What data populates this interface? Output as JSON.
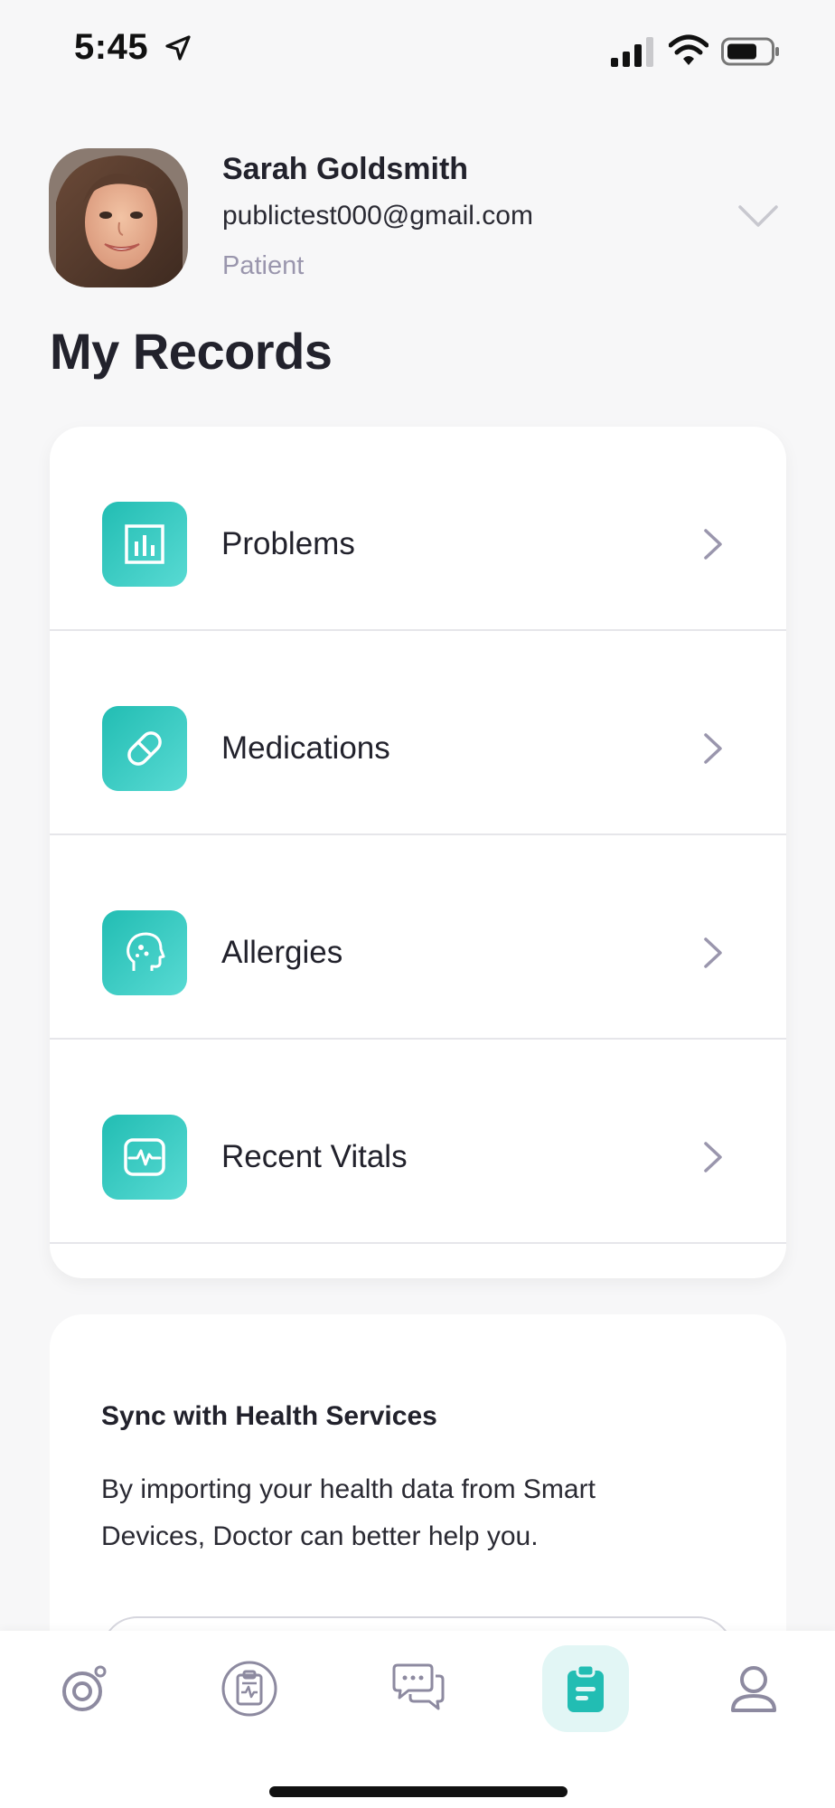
{
  "status_bar": {
    "time": "5:45",
    "icons": [
      "location-arrow-icon",
      "cellular-signal-icon",
      "wifi-icon",
      "battery-icon"
    ]
  },
  "profile": {
    "name": "Sarah Goldsmith",
    "email": "publictest000@gmail.com",
    "role": "Patient"
  },
  "page_title": "My Records",
  "records": [
    {
      "label": "Problems",
      "icon": "bar-chart-icon"
    },
    {
      "label": "Medications",
      "icon": "pill-icon"
    },
    {
      "label": "Allergies",
      "icon": "head-profile-icon"
    },
    {
      "label": "Recent Vitals",
      "icon": "heartbeat-monitor-icon"
    }
  ],
  "sync": {
    "title": "Sync with Health Services",
    "text": "By importing your health data from Smart Devices, Doctor can better help you."
  },
  "tab_bar": {
    "tabs": [
      {
        "name": "home",
        "icon": "target-icon",
        "active": false
      },
      {
        "name": "appointments",
        "icon": "clipboard-ecg-icon",
        "active": false
      },
      {
        "name": "messages",
        "icon": "chat-bubbles-icon",
        "active": false
      },
      {
        "name": "records",
        "icon": "clipboard-icon",
        "active": true
      },
      {
        "name": "profile",
        "icon": "person-icon",
        "active": false
      }
    ]
  },
  "colors": {
    "accent": "#22bdb3",
    "accent_light": "#e2f6f5",
    "text": "#22222c",
    "muted": "#9a96ad",
    "background": "#f7f7f8"
  }
}
